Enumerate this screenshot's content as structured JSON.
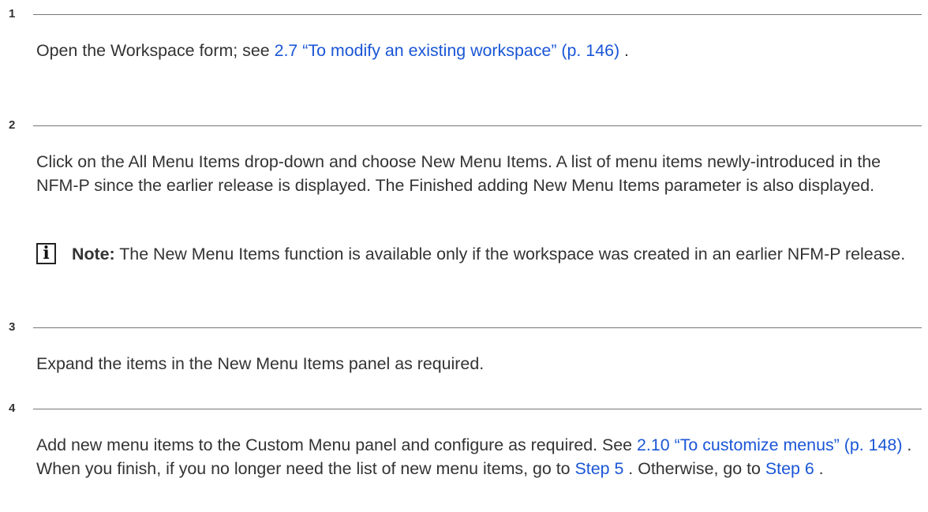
{
  "steps": [
    {
      "number": "1",
      "body": {
        "t1": "Open the Workspace form; see ",
        "link1": "2.7 “To modify an existing workspace” (p. 146)",
        "t2": " ."
      }
    },
    {
      "number": "2",
      "body": {
        "t1": "Click on the All Menu Items drop-down and choose New Menu Items. A list of menu items newly-introduced in the NFM-P since the earlier release is displayed. The Finished adding New Menu Items parameter is also displayed."
      },
      "note": {
        "icon": "i",
        "label": "Note:",
        "text": " The New Menu Items function is available only if the workspace was created in an earlier NFM-P release."
      }
    },
    {
      "number": "3",
      "body": {
        "t1": "Expand the items in the New Menu Items panel as required."
      }
    },
    {
      "number": "4",
      "body": {
        "t1": "Add new menu items to the Custom Menu panel and configure as required. See ",
        "link1": "2.10 “To customize menus” (p. 148)",
        "t2": " . When you finish, if you no longer need the list of new menu items, go to ",
        "link2": "Step 5",
        "t3": " . Otherwise, go to ",
        "link3": "Step 6",
        "t4": " ."
      }
    }
  ]
}
